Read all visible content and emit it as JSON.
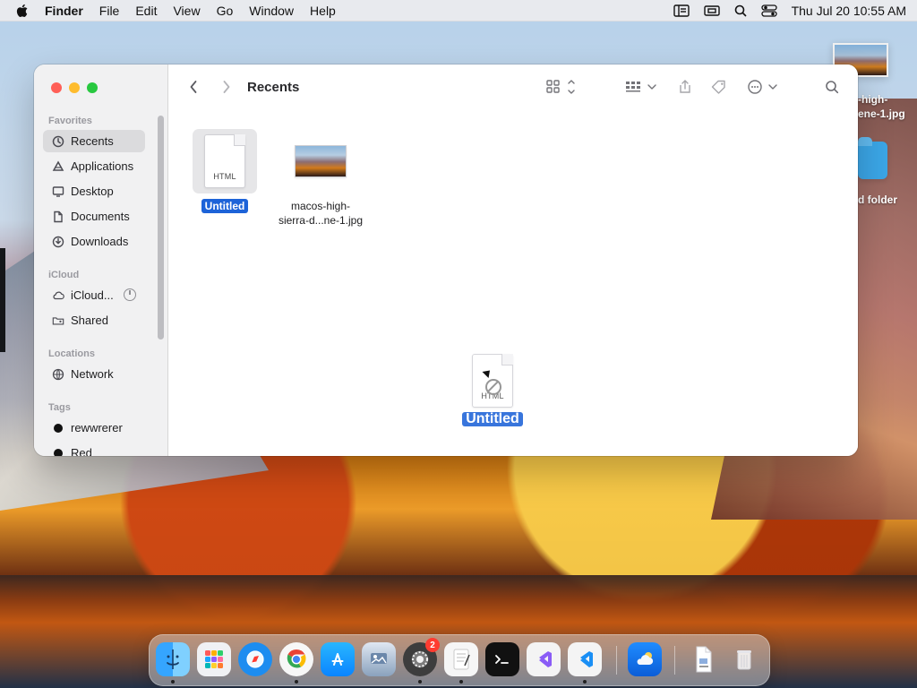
{
  "menu_bar": {
    "apple_icon": "apple-icon",
    "app_name": "Finder",
    "items": [
      "File",
      "Edit",
      "View",
      "Go",
      "Window",
      "Help"
    ],
    "status_icons": [
      "sidebar-icon",
      "screen-mirroring-icon",
      "search-icon",
      "control-center-icon"
    ],
    "clock": "Thu Jul 20  10:55 AM"
  },
  "finder": {
    "title": "Recents",
    "sidebar": {
      "favorites_label": "Favorites",
      "favorites": [
        {
          "label": "Recents",
          "icon": "clock-icon",
          "selected": true
        },
        {
          "label": "Applications",
          "icon": "applications-icon"
        },
        {
          "label": "Desktop",
          "icon": "desktop-icon"
        },
        {
          "label": "Documents",
          "icon": "document-icon"
        },
        {
          "label": "Downloads",
          "icon": "download-icon"
        }
      ],
      "icloud_label": "iCloud",
      "icloud": [
        {
          "label": "iCloud...",
          "icon": "cloud-icon"
        },
        {
          "label": "Shared",
          "icon": "shared-folder-icon"
        }
      ],
      "locations_label": "Locations",
      "locations": [
        {
          "label": "Network",
          "icon": "network-icon"
        }
      ],
      "tags_label": "Tags",
      "tags": [
        {
          "label": "rewwrerer",
          "color": "#111111"
        },
        {
          "label": "Red",
          "color": "#111111"
        }
      ]
    },
    "files": [
      {
        "name": "Untitled",
        "kind_label": "HTML",
        "selected": true
      },
      {
        "name": "macos-high-\nsierra-d...ne-1.jpg",
        "selected": false
      }
    ],
    "dragging": {
      "name": "Untitled",
      "kind_label": "HTML"
    }
  },
  "desktop": {
    "image_label_line1": "-high-",
    "image_label_line2": "ene-1.jpg",
    "folder_label": "d folder"
  },
  "dock": {
    "badge_count": "2"
  }
}
